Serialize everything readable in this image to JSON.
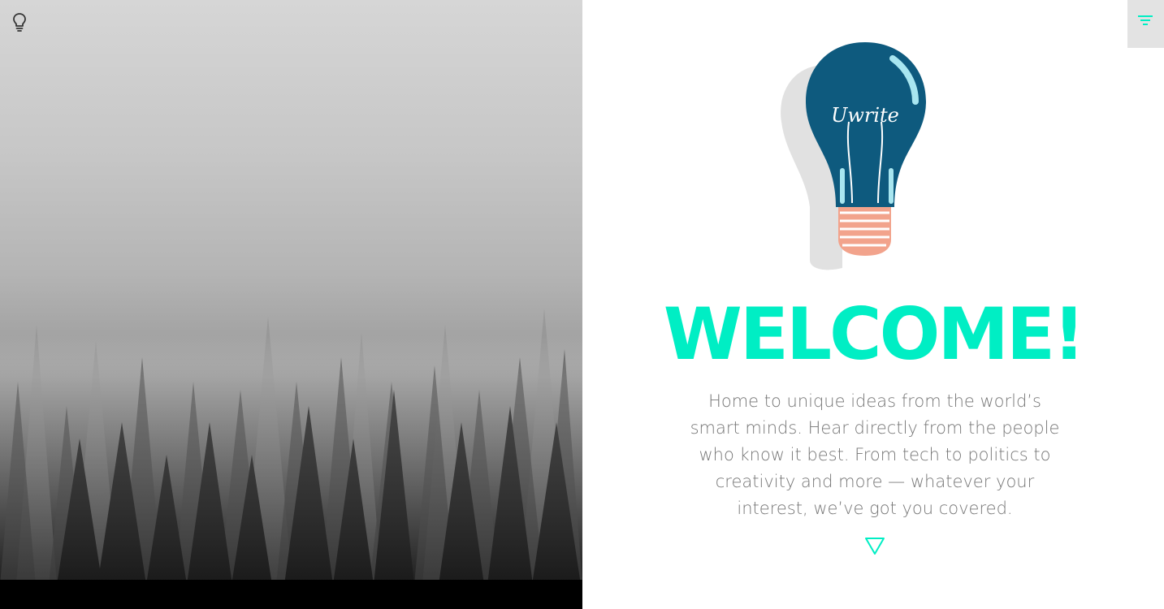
{
  "left_panel": {
    "toggle_icon": "lightbulb-icon"
  },
  "header": {
    "menu_icon": "filter-menu-icon",
    "accent_color": "#00eec4",
    "menu_bg": "#e3e3e3"
  },
  "logo": {
    "wordmark": "Uwrite",
    "colors": {
      "bulb": "#0e5a7e",
      "highlight": "#a8e6f0",
      "base": "#f2a38c",
      "shadow": "#e1e1e1"
    }
  },
  "hero": {
    "title": "WELCOME!",
    "description": "Home to unique ideas from the world’s smart minds. Hear directly from the people who know it best. From tech to politics to creativity and more — whatever your interest, we’ve got you covered.",
    "scroll_icon": "triangle-down-icon"
  }
}
